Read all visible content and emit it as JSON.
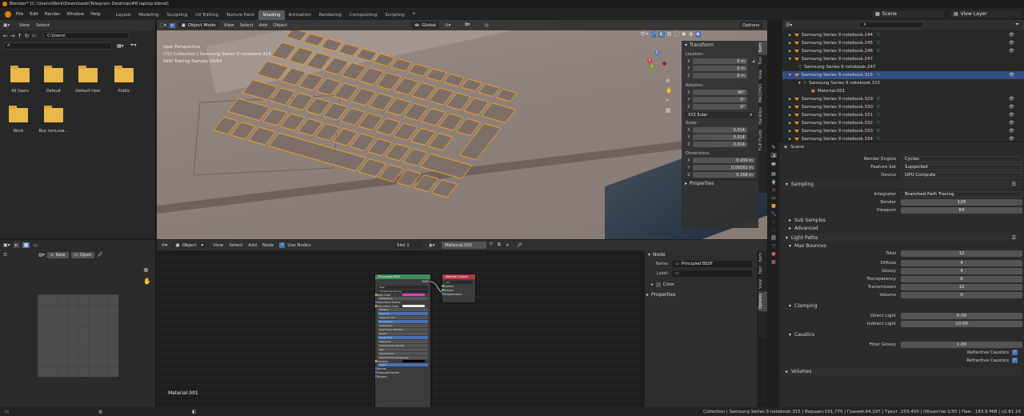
{
  "app": {
    "title": "Blender* [C:\\Users\\Work\\Downloads\\Telegram Desktop\\#8 laptop.blend]"
  },
  "topmenu": [
    "File",
    "Edit",
    "Render",
    "Window",
    "Help"
  ],
  "workspaces": [
    "Layout",
    "Modeling",
    "Sculpting",
    "UV Editing",
    "Texture Paint",
    "Shading",
    "Animation",
    "Rendering",
    "Compositing",
    "Scripting"
  ],
  "active_workspace": "Shading",
  "scene": {
    "name": "Scene",
    "view_layer": "View Layer"
  },
  "filebrowser": {
    "menu": [
      "View",
      "Select"
    ],
    "path": "C:\\Users\\",
    "items": [
      {
        "name": "All Users"
      },
      {
        "name": "Default"
      },
      {
        "name": "Default User"
      },
      {
        "name": "Public"
      },
      {
        "name": "Work"
      },
      {
        "name": "Все пользов..."
      }
    ]
  },
  "viewport": {
    "mode": "Object Mode",
    "menu": [
      "View",
      "Select",
      "Add",
      "Object"
    ],
    "orientation": "Global",
    "options": "Options",
    "info": [
      "User Perspective",
      "(72) Collection | Samsung Series 9 notebook.315",
      "Path Tracing Sample 24/64"
    ],
    "transform": {
      "title": "Transform",
      "location_label": "Location:",
      "location": [
        {
          "axis": "X",
          "value": "0 m"
        },
        {
          "axis": "Y",
          "value": "0 m"
        },
        {
          "axis": "Z",
          "value": "0 m"
        }
      ],
      "rotation_label": "Rotation:",
      "rotation": [
        {
          "axis": "X",
          "value": "90°"
        },
        {
          "axis": "Y",
          "value": "0°"
        },
        {
          "axis": "Z",
          "value": "0°"
        }
      ],
      "rotation_mode": "XYZ Euler",
      "scale_label": "Scale:",
      "scale": [
        {
          "axis": "X",
          "value": "0.014"
        },
        {
          "axis": "Y",
          "value": "0.014"
        },
        {
          "axis": "Z",
          "value": "0.014"
        }
      ],
      "dimensions_label": "Dimensions:",
      "dimensions": [
        {
          "axis": "X",
          "value": "0.439 m"
        },
        {
          "axis": "Y",
          "value": "0.00161 m"
        },
        {
          "axis": "Z",
          "value": "0.168 m"
        }
      ],
      "properties": "Properties"
    },
    "side_tabs": [
      "Item",
      "Tool",
      "View",
      "MACHIN3",
      "HardOps",
      "FLIP Fluids"
    ]
  },
  "outliner": {
    "rows": [
      {
        "label": "Samsung Series 9 notebook.244",
        "selected": false
      },
      {
        "label": "Samsung Series 9 notebook.245",
        "selected": false
      },
      {
        "label": "Samsung Series 9 notebook.246",
        "selected": false
      },
      {
        "label": "Samsung Series 9 notebook.247",
        "selected": false
      },
      {
        "label": "Samsung Series 9 notebook.247",
        "selected": false
      },
      {
        "label": "Samsung Series 9 notebook.315",
        "selected": true
      },
      {
        "label": "Samsung Series 9 notebook.315",
        "selected": false
      },
      {
        "label": "Material.001",
        "selected": false
      },
      {
        "label": "Samsung Series 9 notebook.329",
        "selected": false
      },
      {
        "label": "Samsung Series 9 notebook.330",
        "selected": false
      },
      {
        "label": "Samsung Series 9 notebook.331",
        "selected": false
      },
      {
        "label": "Samsung Series 9 notebook.332",
        "selected": false
      },
      {
        "label": "Samsung Series 9 notebook.333",
        "selected": false
      },
      {
        "label": "Samsung Series 9 notebook.334",
        "selected": false
      }
    ]
  },
  "properties": {
    "scene": "Scene",
    "render_engine_label": "Render Engine",
    "render_engine": "Cycles",
    "feature_set_label": "Feature Set",
    "feature_set": "Supported",
    "device_label": "Device",
    "device": "GPU Compute",
    "sampling": "Sampling",
    "integrator_label": "Integrator",
    "integrator": "Branched Path Tracing",
    "render_label": "Render",
    "render": "128",
    "viewport_label": "Viewport",
    "viewport": "64",
    "sub_samples": "Sub Samples",
    "advanced": "Advanced",
    "light_paths": "Light Paths",
    "max_bounces": "Max Bounces",
    "bounces": [
      {
        "label": "Total",
        "value": "12"
      },
      {
        "label": "Diffuse",
        "value": "4"
      },
      {
        "label": "Glossy",
        "value": "4"
      },
      {
        "label": "Transparency",
        "value": "8"
      },
      {
        "label": "Transmission",
        "value": "12"
      },
      {
        "label": "Volume",
        "value": "0"
      }
    ],
    "clamping": "Clamping",
    "direct_light_label": "Direct Light",
    "direct_light": "0.00",
    "indirect_light_label": "Indirect Light",
    "indirect_light": "10.00",
    "caustics": "Caustics",
    "filter_glossy_label": "Filter Glossy",
    "filter_glossy": "1.00",
    "reflective_caustics": "Reflective Caustics",
    "refractive_caustics": "Refractive Caustics",
    "volumes": "Volumes"
  },
  "image_editor": {
    "new": "New",
    "open": "Open"
  },
  "node_editor": {
    "object": "Object",
    "menu": [
      "View",
      "Select",
      "Add",
      "Node"
    ],
    "use_nodes": "Use Nodes",
    "slot": "Slot 1",
    "material": "Material.001",
    "material_label": "Material.001",
    "side": {
      "tab_node": "Node",
      "name_label": "Name:",
      "name": "Principled BSDF",
      "label_label": "Label:",
      "color": "Color",
      "properties": "Properties"
    },
    "side_tabs": [
      "Item",
      "Tool",
      "View",
      "Options"
    ],
    "bsdf": {
      "title": "Principled BSDF",
      "output": "BSDF",
      "rows": [
        "GGX",
        "Christensen-Burley",
        "Base Color",
        "Subsurface",
        "Subsurface Radius",
        "Subsurface Color",
        "Metallic",
        "Specular",
        "Specular Tint",
        "Roughness",
        "Anisotropic",
        "Anisotropic Rotation",
        "Sheen",
        "Sheen Tint",
        "Clearcoat",
        "Clearcoat Roughness",
        "IOR",
        "Transmission",
        "Transmission Roughness",
        "Emission",
        "Alpha",
        "Normal",
        "Clearcoat Normal",
        "Tangent"
      ]
    },
    "output": {
      "title": "Material Output",
      "target": "All",
      "rows": [
        "Surface",
        "Volume",
        "Displacement"
      ]
    }
  },
  "status": {
    "text": "Collection | Samsung Series 9 notebook.315 | Вершин:101,770 | Граней:94,197 | Треуг.:203,450 | Объектов:1/50 | Пам.: 183.9 MiB | v2.81.16"
  },
  "colors": {
    "accent_orange": "#e89a2c",
    "selection_blue": "#334d80",
    "node_green": "#3c8a5c",
    "node_red": "#b03a46",
    "base_color_pink": "#e839c8"
  }
}
